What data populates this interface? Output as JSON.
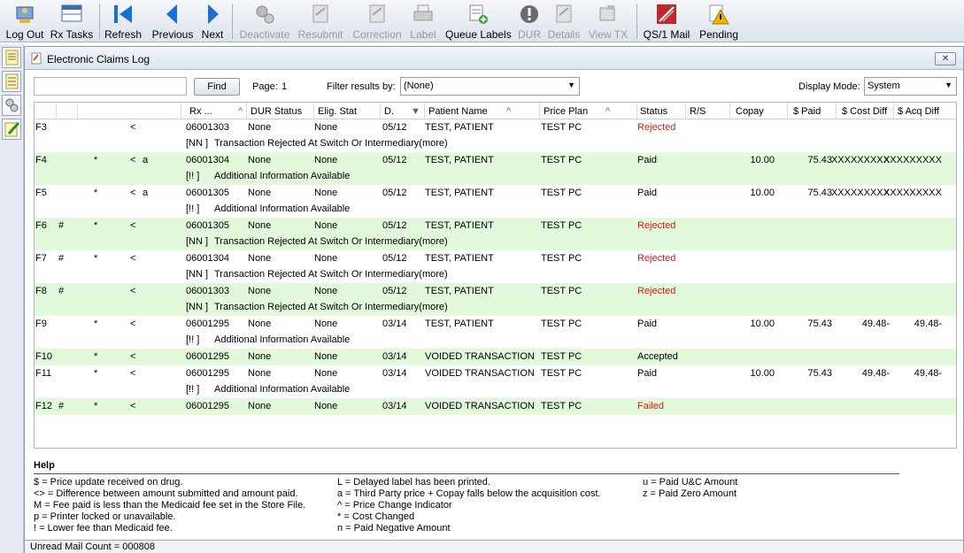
{
  "toolbar": {
    "buttons": [
      {
        "label": "Log Out",
        "icon": "log-out-icon",
        "enabled": true
      },
      {
        "label": "Rx Tasks",
        "icon": "rx-tasks-icon",
        "enabled": true
      },
      {
        "label": "Refresh",
        "icon": "refresh-icon",
        "enabled": true
      },
      {
        "label": "Previous",
        "icon": "previous-arrow-icon",
        "enabled": true
      },
      {
        "label": "Next",
        "icon": "next-arrow-icon",
        "enabled": true
      },
      {
        "label": "Deactivate",
        "icon": "gears-icon",
        "enabled": false
      },
      {
        "label": "Resubmit",
        "icon": "resubmit-icon",
        "enabled": false
      },
      {
        "label": "Correction",
        "icon": "correction-icon",
        "enabled": false
      },
      {
        "label": "Label",
        "icon": "printer-icon",
        "enabled": false
      },
      {
        "label": "Queue Labels",
        "icon": "queue-labels-icon",
        "enabled": true
      },
      {
        "label": "DUR",
        "icon": "dur-alert-icon",
        "enabled": false
      },
      {
        "label": "Details",
        "icon": "details-icon",
        "enabled": false
      },
      {
        "label": "View TX",
        "icon": "view-tx-icon",
        "enabled": false
      },
      {
        "label": "QS/1 Mail",
        "icon": "mail-icon",
        "enabled": true
      },
      {
        "label": "Pending",
        "icon": "pending-warning-icon",
        "enabled": true
      }
    ]
  },
  "window": {
    "title": "Electronic Claims Log",
    "close": "✕"
  },
  "filters": {
    "search_value": "",
    "find_label": "Find",
    "page_label": "Page:",
    "page_number": "1",
    "filter_label": "Filter results by:",
    "filter_value": "(None)",
    "display_mode_label": "Display Mode:",
    "display_mode_value": "System"
  },
  "grid": {
    "columns": [
      "Rx ...",
      "DUR Status",
      "Elig. Stat",
      "D.",
      "Patient Name",
      "Price Plan",
      "Status",
      "R/S",
      "Copay",
      "$ Paid",
      "$ Cost Diff",
      "$ Acq Diff"
    ],
    "rows": [
      {
        "key": "F3",
        "flag": "",
        "star": "",
        "ind": "<",
        "a": "",
        "rx": "06001303",
        "dur": "None",
        "elig": "None",
        "date": "05/12",
        "patient": "TEST, PATIENT",
        "plan": "TEST PC",
        "status": "Rejected",
        "copay": "",
        "paid": "",
        "cost": "",
        "acq": "",
        "note_code": "[NN ]",
        "note": "Transaction Rejected At Switch Or Intermediary(more)",
        "green": false
      },
      {
        "key": "F4",
        "flag": "",
        "star": "*",
        "ind": "<",
        "a": "a",
        "rx": "06001304",
        "dur": "None",
        "elig": "None",
        "date": "05/12",
        "patient": "TEST, PATIENT",
        "plan": "TEST PC",
        "status": "Paid",
        "copay": "10.00",
        "paid": "75.43",
        "cost": "XXXXXXXXX",
        "acq": "XXXXXXXXX",
        "note_code": "[!! ]",
        "note": "Additional Information Available",
        "green": true
      },
      {
        "key": "F5",
        "flag": "",
        "star": "*",
        "ind": "<",
        "a": "a",
        "rx": "06001305",
        "dur": "None",
        "elig": "None",
        "date": "05/12",
        "patient": "TEST, PATIENT",
        "plan": "TEST PC",
        "status": "Paid",
        "copay": "10.00",
        "paid": "75.43",
        "cost": "XXXXXXXXX",
        "acq": "XXXXXXXXX",
        "note_code": "[!! ]",
        "note": "Additional Information Available",
        "green": false
      },
      {
        "key": "F6",
        "flag": "#",
        "star": "*",
        "ind": "<",
        "a": "",
        "rx": "06001305",
        "dur": "None",
        "elig": "None",
        "date": "05/12",
        "patient": "TEST, PATIENT",
        "plan": "TEST PC",
        "status": "Rejected",
        "copay": "",
        "paid": "",
        "cost": "",
        "acq": "",
        "note_code": "[NN ]",
        "note": "Transaction Rejected At Switch Or Intermediary(more)",
        "green": true
      },
      {
        "key": "F7",
        "flag": "#",
        "star": "*",
        "ind": "<",
        "a": "",
        "rx": "06001304",
        "dur": "None",
        "elig": "None",
        "date": "05/12",
        "patient": "TEST, PATIENT",
        "plan": "TEST PC",
        "status": "Rejected",
        "copay": "",
        "paid": "",
        "cost": "",
        "acq": "",
        "note_code": "[NN ]",
        "note": "Transaction Rejected At Switch Or Intermediary(more)",
        "green": false
      },
      {
        "key": "F8",
        "flag": "#",
        "star": "",
        "ind": "<",
        "a": "",
        "rx": "06001303",
        "dur": "None",
        "elig": "None",
        "date": "05/12",
        "patient": "TEST, PATIENT",
        "plan": "TEST PC",
        "status": "Rejected",
        "copay": "",
        "paid": "",
        "cost": "",
        "acq": "",
        "note_code": "[NN ]",
        "note": "Transaction Rejected At Switch Or Intermediary(more)",
        "green": true
      },
      {
        "key": "F9",
        "flag": "",
        "star": "*",
        "ind": "<",
        "a": "",
        "rx": "06001295",
        "dur": "None",
        "elig": "None",
        "date": "03/14",
        "patient": "TEST, PATIENT",
        "plan": "TEST PC",
        "status": "Paid",
        "copay": "10.00",
        "paid": "75.43",
        "cost": "49.48-",
        "acq": "49.48-",
        "note_code": "[!! ]",
        "note": "Additional Information Available",
        "green": false
      },
      {
        "key": "F10",
        "flag": "",
        "star": "*",
        "ind": "<",
        "a": "",
        "rx": "06001295",
        "dur": "None",
        "elig": "None",
        "date": "03/14",
        "patient": "VOIDED TRANSACTION",
        "plan": "TEST PC",
        "status": "Accepted",
        "copay": "",
        "paid": "",
        "cost": "",
        "acq": "",
        "note_code": "",
        "note": "",
        "green": true
      },
      {
        "key": "F11",
        "flag": "",
        "star": "*",
        "ind": "<",
        "a": "",
        "rx": "06001295",
        "dur": "None",
        "elig": "None",
        "date": "03/14",
        "patient": "VOIDED TRANSACTION",
        "plan": "TEST PC",
        "status": "Paid",
        "copay": "10.00",
        "paid": "75.43",
        "cost": "49.48-",
        "acq": "49.48-",
        "note_code": "[!! ]",
        "note": "Additional Information Available",
        "green": false
      },
      {
        "key": "F12",
        "flag": "#",
        "star": "*",
        "ind": "<",
        "a": "",
        "rx": "06001295",
        "dur": "None",
        "elig": "None",
        "date": "03/14",
        "patient": "VOIDED TRANSACTION",
        "plan": "TEST PC",
        "status": "Failed",
        "copay": "",
        "paid": "",
        "cost": "",
        "acq": "",
        "note_code": "",
        "note": "",
        "green": true
      }
    ]
  },
  "help": {
    "title": "Help",
    "col1": [
      "$ = Price update received on drug.",
      "<> = Difference between amount submitted and amount paid.",
      "M = Fee paid is less than the Medicaid fee set in the Store File.",
      "p = Printer locked or unavailable.",
      "! = Lower fee than Medicaid fee."
    ],
    "col2": [
      "L = Delayed label has been printed.",
      "a = Third Party price + Copay falls below the acquisition cost.",
      "^ = Price Change Indicator",
      "* = Cost Changed",
      "n = Paid Negative Amount"
    ],
    "col3": [
      "u = Paid U&C Amount",
      "z = Paid Zero Amount"
    ]
  },
  "status_bar": "Unread Mail Count = 000808",
  "colors": {
    "row_green": "#e3f9dc",
    "rejected": "#d21b1b",
    "toolbar_blue": "#1a6fd6"
  }
}
